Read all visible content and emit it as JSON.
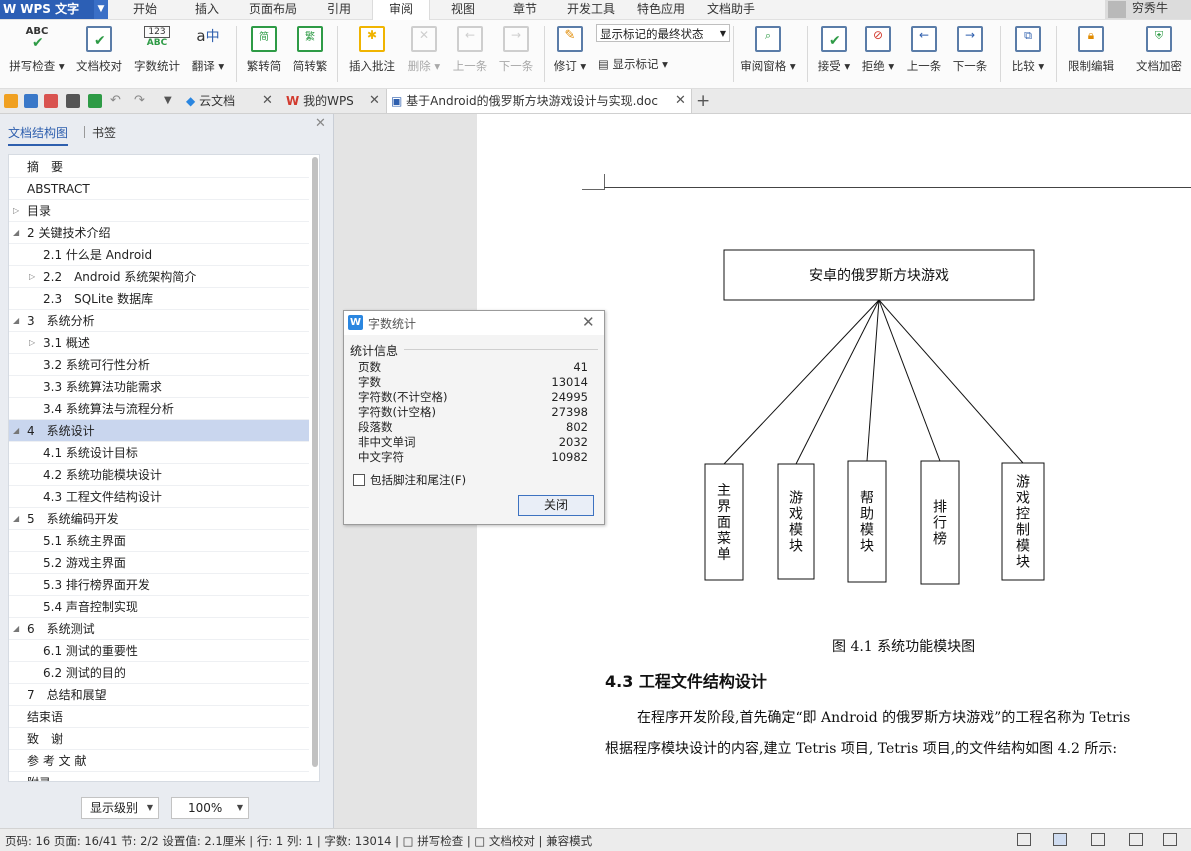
{
  "app": {
    "logo": "WPS 文字",
    "menu_tabs": [
      "开始",
      "插入",
      "页面布局",
      "引用",
      "审阅",
      "视图",
      "章节",
      "开发工具",
      "特色应用",
      "文档助手"
    ],
    "active_tab": "审阅",
    "user_name": "穷秀牛"
  },
  "ribbon": {
    "spell_check": "拼写检查",
    "doc_proof": "文档校对",
    "word_count": "字数统计",
    "translate": "翻译",
    "to_simplified": "繁转简",
    "to_traditional": "简转繁",
    "insert_comment": "插入批注",
    "delete": "删除",
    "previous": "上一条",
    "next": "下一条",
    "revise": "修订",
    "markup_state": "显示标记的最终状态",
    "show_markup": "显示标记",
    "review_pane": "审阅窗格",
    "accept": "接受",
    "reject": "拒绝",
    "prev_change": "上一条",
    "next_change": "下一条",
    "compare": "比较",
    "restrict_edit": "限制编辑",
    "encrypt": "文档加密"
  },
  "tabs": {
    "cloud_docs": "云文档",
    "my_wps": "我的WPS",
    "document": "基于Android的俄罗斯方块游戏设计与实现.doc"
  },
  "nav": {
    "tab_outline": "文档结构图",
    "tab_bookmarks": "书签",
    "items": [
      "摘　要",
      "ABSTRACT",
      "目录",
      "2 关键技术介绍",
      "2.1  什么是 Android",
      "2.2　Android 系统架构简介",
      "2.3　SQLite 数据库",
      "3　系统分析",
      "3.1 概述",
      "3.2  系统可行性分析",
      "3.3  系统算法功能需求",
      "3.4  系统算法与流程分析",
      "4　系统设计",
      "4.1  系统设计目标",
      "4.2  系统功能模块设计",
      "4.3  工程文件结构设计",
      "5　系统编码开发",
      "5.1 系统主界面",
      "5.2 游戏主界面",
      "5.3 排行榜界面开发",
      "5.4 声音控制实现",
      "6　系统测试",
      "6.1 测试的重要性",
      "6.2 测试的目的",
      "7　总结和展望",
      "结束语",
      "致　谢",
      "参 考 文 献",
      "附录"
    ],
    "selected_index": 12,
    "level_select": "显示级别",
    "zoom": "100%"
  },
  "dialog": {
    "title": "字数统计",
    "group_label": "统计信息",
    "stats": [
      {
        "label": "页数",
        "value": "41"
      },
      {
        "label": "字数",
        "value": "13014"
      },
      {
        "label": "字符数(不计空格)",
        "value": "24995"
      },
      {
        "label": "字符数(计空格)",
        "value": "27398"
      },
      {
        "label": "段落数",
        "value": "802"
      },
      {
        "label": "非中文单词",
        "value": "2032"
      },
      {
        "label": "中文字符",
        "value": "10982"
      }
    ],
    "include_footnotes": "包括脚注和尾注(F)",
    "close_button": "关闭"
  },
  "document": {
    "diagram_root": "安卓的俄罗斯方块游戏",
    "diagram_children": [
      "主界面菜单",
      "游戏模块",
      "帮助模块",
      "排行榜",
      "游戏控制模块"
    ],
    "figure_caption": "图  4.1  系统功能模块图",
    "section_heading": "4.3  工程文件结构设计",
    "para1": "在程序开发阶段,首先确定“即 Android 的俄罗斯方块游戏”的工程名称为 Tetris",
    "para2": "根据程序模块设计的内容,建立 Tetris 项目, Tetris 项目,的文件结构如图 4.2 所示:"
  },
  "status": {
    "text": "页码: 16   页面: 16/41   节: 2/2   设置值: 2.1厘米 | 行: 1   列: 1 | 字数: 13014 | □ 拼写检查 | □ 文档校对 |    兼容模式"
  }
}
